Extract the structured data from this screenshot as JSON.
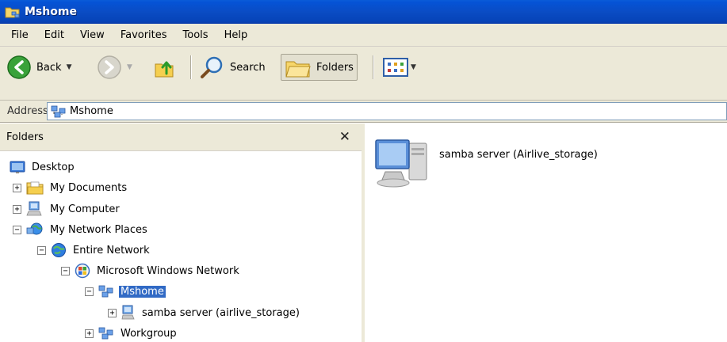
{
  "window": {
    "title": "Mshome"
  },
  "menu": {
    "items": [
      "File",
      "Edit",
      "View",
      "Favorites",
      "Tools",
      "Help"
    ]
  },
  "toolbar": {
    "back_label": "Back",
    "search_label": "Search",
    "folders_label": "Folders"
  },
  "address": {
    "label": "Address",
    "value": "Mshome"
  },
  "folders_pane": {
    "title": "Folders",
    "tree": [
      {
        "label": "Desktop",
        "expander": ""
      },
      {
        "label": "My Documents",
        "expander": "+"
      },
      {
        "label": "My Computer",
        "expander": "+"
      },
      {
        "label": "My Network Places",
        "expander": "−"
      },
      {
        "label": "Entire Network",
        "expander": "−"
      },
      {
        "label": "Microsoft Windows Network",
        "expander": "−"
      },
      {
        "label": "Mshome",
        "expander": "−",
        "selected": true
      },
      {
        "label": "samba server (airlive_storage)",
        "expander": "+"
      },
      {
        "label": "Workgroup",
        "expander": "+"
      }
    ]
  },
  "content": {
    "items": [
      {
        "label": "samba server (Airlive_storage)"
      }
    ]
  },
  "colors": {
    "titlebar": "#0553d6",
    "chrome": "#ece9d8",
    "selection": "#316ac5"
  }
}
